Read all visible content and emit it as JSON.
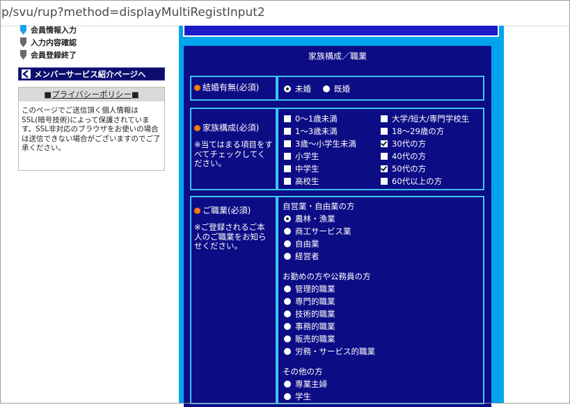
{
  "browser": {
    "url": "p/svu/rup?method=displayMultiRegistInput2"
  },
  "sidebar": {
    "steps": [
      {
        "label": "会員情報入力",
        "color": "#1a9fe8"
      },
      {
        "label": "入力内容確認",
        "color": "#6a6a6a"
      },
      {
        "label": "会員登録終了",
        "color": "#6a6a6a"
      }
    ],
    "service_link": "メンバーサービス紹介ページへ",
    "privacy": {
      "title_prefix": "■",
      "title_link": "プライバシーポリシー",
      "title_suffix": "■",
      "body": "このページでご送信頂く個人情報はSSL(暗号技術)によって保護されています。SSL非対応のブラウザをお使いの場合は送信できない場合がございますのでご了承ください。"
    }
  },
  "form": {
    "section_title": "家族構成／職業",
    "marital": {
      "label": "結婚有無(必須)",
      "options": [
        {
          "label": "未婚",
          "selected": true
        },
        {
          "label": "既婚",
          "selected": false
        }
      ]
    },
    "family": {
      "label": "家族構成(必須)",
      "note": "※当てはまる項目をすべてチェックしてください。",
      "options_left": [
        {
          "label": "0〜1歳未満",
          "checked": false
        },
        {
          "label": "1〜3歳未満",
          "checked": false
        },
        {
          "label": "3歳〜小学生未満",
          "checked": false
        },
        {
          "label": "小学生",
          "checked": false
        },
        {
          "label": "中学生",
          "checked": false
        },
        {
          "label": "高校生",
          "checked": false
        }
      ],
      "options_right": [
        {
          "label": "大学/短大/専門学校生",
          "checked": false
        },
        {
          "label": "18〜29歳の方",
          "checked": false
        },
        {
          "label": "30代の方",
          "checked": true
        },
        {
          "label": "40代の方",
          "checked": false
        },
        {
          "label": "50代の方",
          "checked": true
        },
        {
          "label": "60代以上の方",
          "checked": false
        }
      ]
    },
    "occupation": {
      "label": "ご職業(必須)",
      "note": "※ご登録されるご本人のご職業をお知らせください。",
      "groups": [
        {
          "title": "自営業・自由業の方",
          "options": [
            "農林・漁業",
            "商工サービス業",
            "自由業",
            "経営者"
          ]
        },
        {
          "title": "お勤めの方や公務員の方",
          "options": [
            "管理的職業",
            "専門的職業",
            "技術的職業",
            "事務的職業",
            "販売的職業",
            "労務・サービス的職業"
          ]
        },
        {
          "title": "その他の方",
          "options": [
            "専業主婦",
            "学生"
          ]
        }
      ],
      "selected": "農林・漁業"
    }
  },
  "colors": {
    "form_bg": "#0c0c85",
    "cell_border": "#3fc2f7",
    "outer_bg": "#00a4ec",
    "required_bullet": "#f47a0a"
  }
}
